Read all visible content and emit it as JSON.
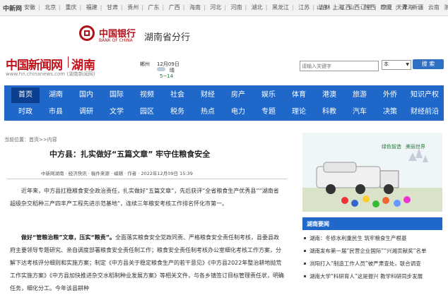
{
  "topbar": {
    "brand": "中新网",
    "regions": [
      "安徽",
      "北京",
      "重庆",
      "福建",
      "甘肃",
      "贵州",
      "广东",
      "广西",
      "海南",
      "河北",
      "河南",
      "湖北",
      "黑龙江",
      "江苏",
      "吉林",
      "江西",
      "辽宁",
      "宁夏",
      "青海"
    ],
    "right": [
      "山东",
      "上海",
      "山西",
      "陕西",
      "四川",
      "天津",
      "新疆",
      "云南",
      "浙江"
    ]
  },
  "ad": {
    "bank_name": "中国银行",
    "bank_en": "BANK OF CHINA",
    "branch": "湖南省分行"
  },
  "site": {
    "logo_cn": "中国新闻网",
    "logo_region": "湖南",
    "url": "www.hn.chinanews.com (湖南新闻网)"
  },
  "weather": {
    "city": "郴州",
    "date": "12月09日",
    "condition": "晴",
    "temp": "5~14",
    "temp_color": "#1a7a2a"
  },
  "search": {
    "placeholder": "请输入关键字",
    "select_value": "本",
    "button": "搜 索"
  },
  "nav": {
    "color": "#1f67c8",
    "row1": [
      "首页",
      "湖南",
      "国内",
      "国际",
      "视频",
      "社会",
      "财经",
      "房产",
      "娱乐",
      "体育",
      "港澳",
      "旅游",
      "外侨",
      "知识产权"
    ],
    "row2": [
      "时政",
      "市县",
      "调研",
      "文学",
      "园区",
      "税务",
      "热点",
      "电力",
      "专题",
      "理论",
      "科教",
      "汽车",
      "决策",
      "财经前沿"
    ]
  },
  "breadcrumb": "当前位置：首页>>内容",
  "article": {
    "title": "中方县：扎实做好“五篇文章” 牢守住粮食安全",
    "meta": "中新网湖南 · 经济快讯 · 稿件来源 · 编辑 · 作者 · 2022年12月09日 15:39",
    "p1": "近年来，中方县扛稳粮食安全政治责任，扎实做好“五篇文章”，先后获评“全省粮食生产优秀县”“湖南省超级杂交稻种三产四丰产工程先进示范基地”，连续三年粮安考核工作排名怀化市第一。",
    "p2_lead": "做好“管粮治粮”文章，压实“粮责”。",
    "p2": "全面落实粮食安全党政同责、严格粮食安全责任制考核，县委县政府主要领导专题研究、亲自调度部署粮食安全责任制工作；粮食安全责任制考核办公室细化考核工作方案，分解下达考核评分细则和实施方案；制定《中方县关于稳定粮食生产的若干意见》《中方县2022年整治耕地抛荒工作实施方案》《中方县加快推进杂交水稻制种业发展方案》等相关文件，与各乡镇签订目标管理责任状，明确任务，细化分工。今年该县耕种"
  },
  "banner": {
    "slogan_a": "绿色智造",
    "slogan_b": "美丽世界"
  },
  "related": {
    "header": "湖南要闻",
    "items": [
      "湖南：冬修水利重民生 筑牢粮食生产根基",
      "湖南发布第一届“民营企业国际”“兴湘贡献奖”名单",
      "浏阳打入“制造工作人员”被严肃查处，联合调查",
      "湖南大学“科研育人”这是振兴 教学科研同步发展"
    ]
  }
}
